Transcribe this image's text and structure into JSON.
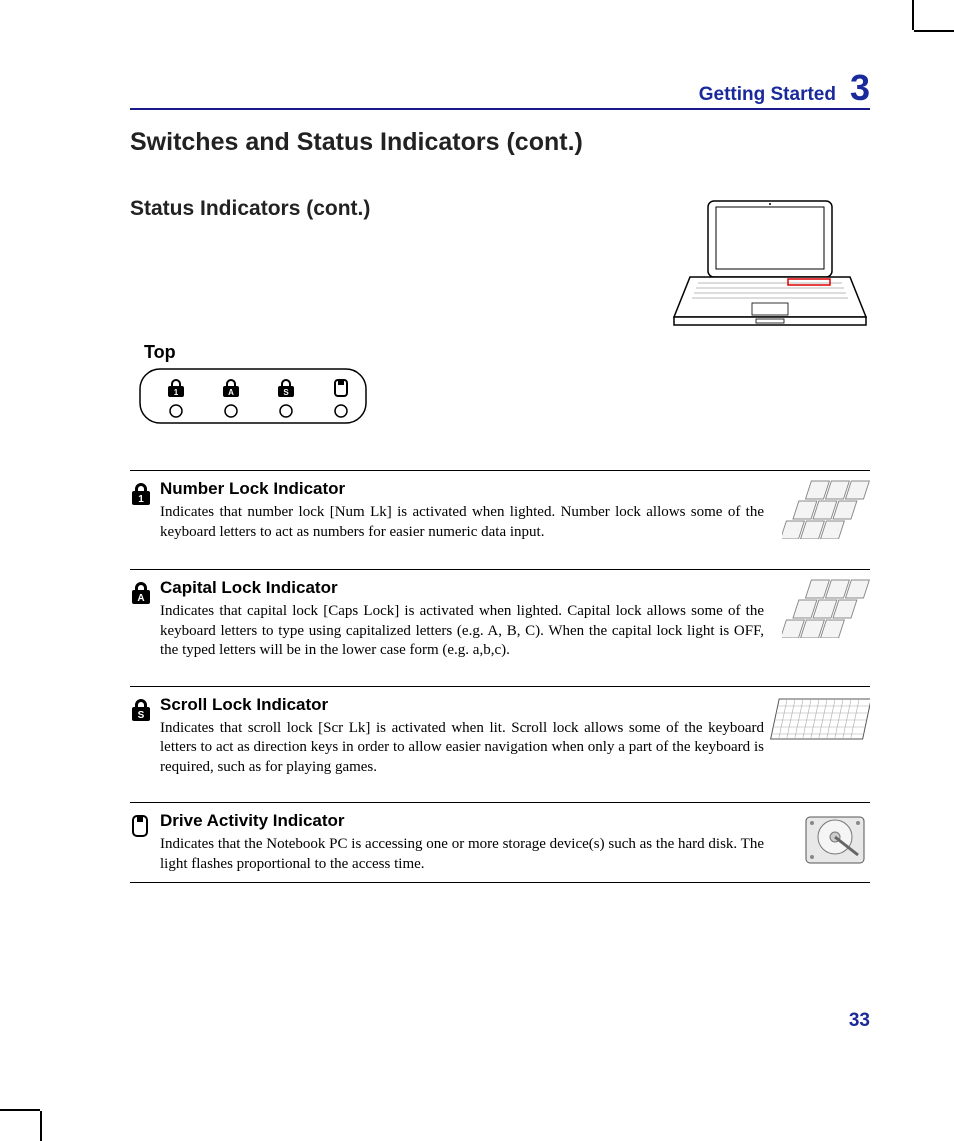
{
  "header": {
    "section": "Getting Started",
    "chapter": "3"
  },
  "title": "Switches and Status Indicators (cont.)",
  "subtitle": "Status Indicators (cont.)",
  "top_label": "Top",
  "panel_icons": [
    "num-lock",
    "caps-lock",
    "scroll-lock",
    "drive"
  ],
  "items": [
    {
      "icon": "num-lock",
      "title": "Number Lock Indicator",
      "body": "Indicates that number lock [Num Lk] is activated when lighted. Number lock allows some of the  keyboard letters to act as numbers for easier numeric data input.",
      "image": "keyboard-keys"
    },
    {
      "icon": "caps-lock",
      "title": "Capital Lock Indicator",
      "body": "Indicates that capital lock [Caps Lock] is activated when lighted. Capital lock allows some of the keyboard letters to type using capitalized letters (e.g. A, B, C). When the capital lock light is OFF, the typed letters will be in the lower case form (e.g. a,b,c).",
      "image": "keyboard-keys"
    },
    {
      "icon": "scroll-lock",
      "title": "Scroll Lock Indicator",
      "body": "Indicates that scroll lock [Scr Lk] is activated when lit. Scroll lock allows some of the keyboard letters to act as direction keys in order to allow easier navigation when only a part of the keyboard is required, such as for playing games.",
      "image": "full-keyboard"
    },
    {
      "icon": "drive",
      "title": "Drive Activity Indicator",
      "body": "Indicates that the Notebook PC is accessing one or more storage device(s) such as the hard disk. The light flashes proportional to the access time.",
      "image": "hard-disk"
    }
  ],
  "page_number": "33"
}
